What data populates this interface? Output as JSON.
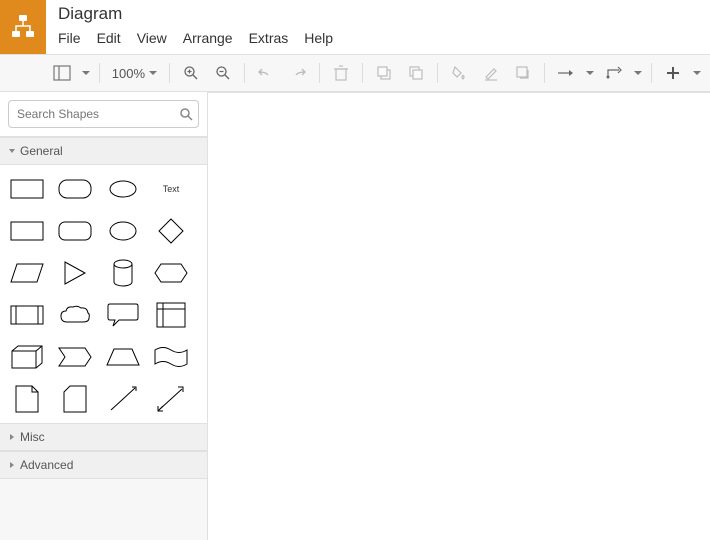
{
  "app": {
    "title": "Diagram"
  },
  "menu": {
    "items": [
      "File",
      "Edit",
      "View",
      "Arrange",
      "Extras",
      "Help"
    ]
  },
  "toolbar": {
    "zoom": "100%"
  },
  "search": {
    "placeholder": "Search Shapes"
  },
  "palette": {
    "sections": [
      {
        "label": "General",
        "expanded": true
      },
      {
        "label": "Misc",
        "expanded": false
      },
      {
        "label": "Advanced",
        "expanded": false
      }
    ],
    "text_shape_label": "Text"
  }
}
